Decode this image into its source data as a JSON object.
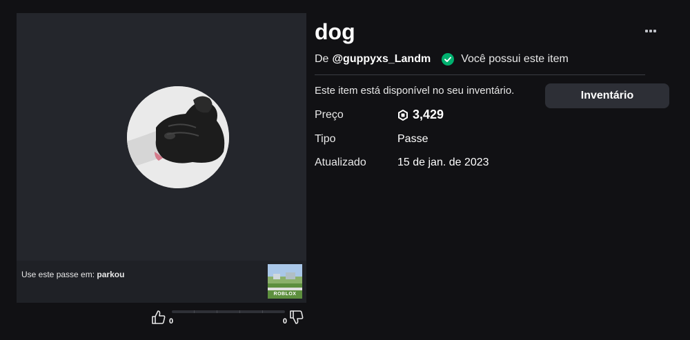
{
  "item": {
    "title": "dog",
    "creator_prefix": "De",
    "creator_name": "@guppyxs_Landm",
    "owned_text": "Você possui este item",
    "available_text": "Este item está disponível no seu inventário.",
    "inventory_button": "Inventário"
  },
  "details": {
    "price_label": "Preço",
    "price_value": "3,429",
    "type_label": "Tipo",
    "type_value": "Passe",
    "updated_label": "Atualizado",
    "updated_value": "15 de jan. de 2023"
  },
  "place": {
    "prefix": "Use este passe em:",
    "name": "parkou",
    "thumb_label": "ROBLOX"
  },
  "votes": {
    "up_count": "0",
    "down_count": "0"
  },
  "colors": {
    "background": "#111114",
    "panel": "#24262c",
    "owned_check": "#00b06f",
    "button": "#2d2f36"
  },
  "icons": {
    "more": "more-horizontal-icon",
    "owned": "check-circle-icon",
    "currency": "robux-icon",
    "thumbs_up": "thumbs-up-icon",
    "thumbs_down": "thumbs-down-icon"
  }
}
